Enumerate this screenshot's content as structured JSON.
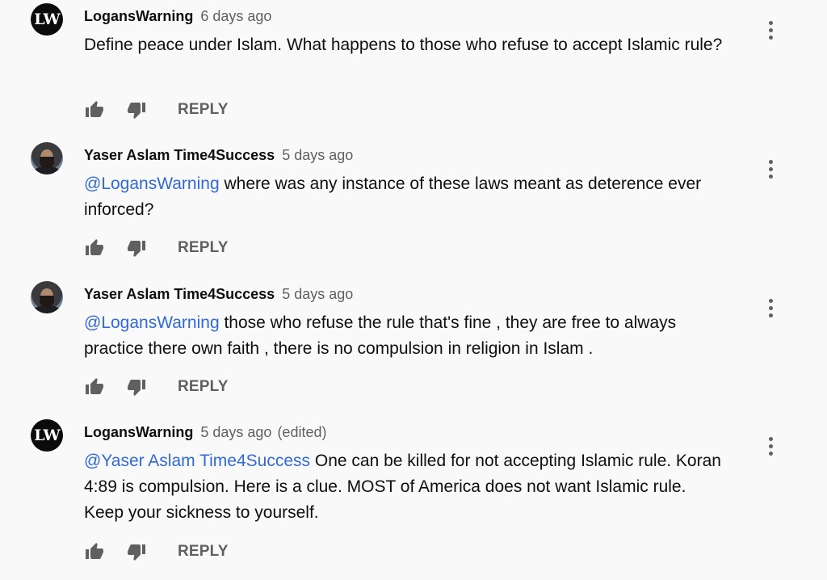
{
  "comments": [
    {
      "avatar": {
        "type": "initials",
        "initials": "LW"
      },
      "author": "LogansWarning",
      "time": "6 days ago",
      "edited": "",
      "mention": "",
      "text": "Define peace under Islam. What happens to those who refuse to accept Islamic rule?",
      "reply_label": "REPLY"
    },
    {
      "avatar": {
        "type": "photo"
      },
      "author": "Yaser Aslam Time4Success",
      "time": "5 days ago",
      "edited": "",
      "mention": "@LogansWarning",
      "text": " where was any instance of these laws meant as deterence ever inforced?",
      "reply_label": "REPLY"
    },
    {
      "avatar": {
        "type": "photo"
      },
      "author": "Yaser Aslam Time4Success",
      "time": "5 days ago",
      "edited": "",
      "mention": "@LogansWarning",
      "text": " those who refuse the rule that's fine , they are free to always practice there own faith , there is no compulsion in religion in Islam .",
      "reply_label": "REPLY"
    },
    {
      "avatar": {
        "type": "initials",
        "initials": "LW"
      },
      "author": "LogansWarning",
      "time": "5 days ago",
      "edited": "(edited)",
      "mention": "@Yaser Aslam Time4Success",
      "text": " One can be killed for not accepting Islamic rule. Koran 4:89 is compulsion. Here is a clue. MOST of America does not want Islamic rule. Keep your sickness to yourself.",
      "reply_label": "REPLY"
    }
  ],
  "icons": {
    "like": "thumb-up-icon",
    "dislike": "thumb-down-icon",
    "menu": "more-vert-icon"
  },
  "colors": {
    "background": "#f9f9f9",
    "text": "#0f0f0f",
    "secondary": "#606060",
    "mention": "#3169d6"
  }
}
